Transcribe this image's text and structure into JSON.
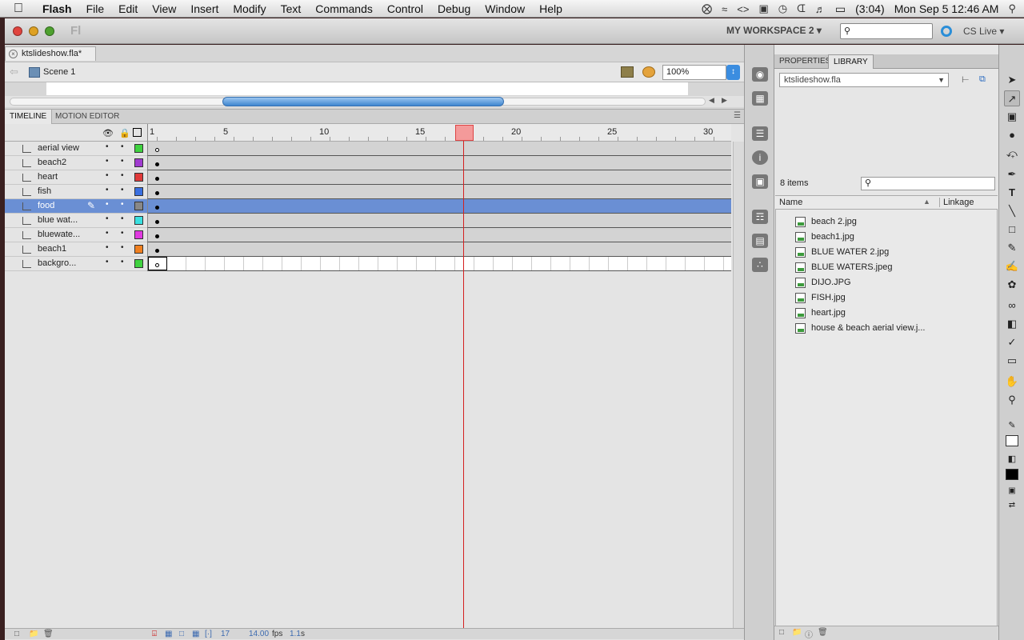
{
  "menubar": {
    "app_name": "Flash",
    "items": [
      "File",
      "Edit",
      "View",
      "Insert",
      "Modify",
      "Text",
      "Commands",
      "Control",
      "Debug",
      "Window",
      "Help"
    ],
    "battery": "(3:04)",
    "datetime": "Mon Sep 5  12:46 AM"
  },
  "window": {
    "logo": "Fl",
    "workspace": "MY WORKSPACE 2 ▾",
    "cslive": "CS Live ▾"
  },
  "document": {
    "tab": "ktslideshow.fla*",
    "scene": "Scene 1",
    "zoom": "100%"
  },
  "timeline": {
    "tabs": [
      "TIMELINE",
      "MOTION EDITOR"
    ],
    "ruler": [
      "1",
      "5",
      "10",
      "15",
      "20",
      "25",
      "30"
    ],
    "current_frame": 17,
    "layers": [
      {
        "name": "aerial view",
        "color": "#3fd23f",
        "key": "empty"
      },
      {
        "name": "beach2",
        "color": "#a03bd0",
        "key": "filled"
      },
      {
        "name": "heart",
        "color": "#e03a3a",
        "key": "filled"
      },
      {
        "name": "fish",
        "color": "#3a6fe0",
        "key": "filled"
      },
      {
        "name": "food",
        "color": "#888888",
        "key": "filled",
        "selected": true
      },
      {
        "name": "blue wat...",
        "color": "#3ae0e0",
        "key": "filled"
      },
      {
        "name": "bluewate...",
        "color": "#e03ae0",
        "key": "filled"
      },
      {
        "name": "beach1",
        "color": "#f08020",
        "key": "filled"
      },
      {
        "name": "backgro...",
        "color": "#3fd23f",
        "key": "empty"
      }
    ],
    "footer": {
      "frame": "17",
      "fps": "14.00",
      "fps_unit": "fps",
      "time": "1.1",
      "time_unit": "s"
    }
  },
  "library": {
    "tabs": [
      "PROPERTIES",
      "LIBRARY"
    ],
    "file": "ktslideshow.fla",
    "count": "8 items",
    "columns": [
      "Name",
      "Linkage"
    ],
    "items": [
      "beach 2.jpg",
      "beach1.jpg",
      "BLUE WATER 2.jpg",
      "BLUE WATERS.jpeg",
      "DIJO.JPG",
      "FISH.jpg",
      "heart.jpg",
      "house & beach aerial view.j..."
    ]
  }
}
